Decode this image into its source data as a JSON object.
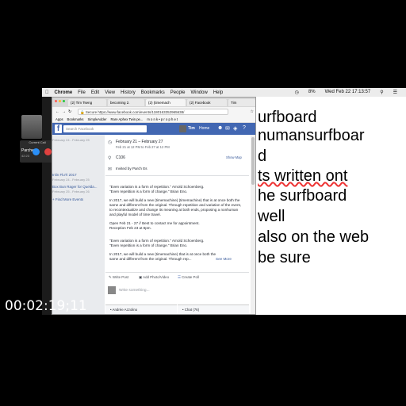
{
  "menubar": {
    "app": "Chrome",
    "items": [
      "File",
      "Edit",
      "View",
      "History",
      "Bookmarks",
      "People",
      "Window",
      "Help"
    ],
    "clock": "Wed Feb 22  17:13:57",
    "battery": "8%"
  },
  "call": {
    "header": "Current Call",
    "name": "Parches",
    "duration": "42:23"
  },
  "tabs": [
    "(2) Tim Tseng",
    "becoming 2.",
    "(2) (timemach",
    "(2) Facebook",
    "Tim"
  ],
  "url": "Secure  https://www.facebook.com/events/1180163352965638/",
  "bookmarks": [
    "Apps",
    "Bookmarks",
    "SimpleAdder",
    "Rare Aphex Twin pe...",
    "m o n k • p r o p h e t"
  ],
  "fb": {
    "search_placeholder": "Search Facebook",
    "user": "Tim",
    "nav_home": "Home",
    "left_items": [
      {
        "title": "Inlin FluTi 2017",
        "sub": "February 24 - February 25"
      },
      {
        "title": "Box Bun Rager for Quelda...",
        "sub": "February 25 - February 26"
      },
      {
        "title": "+ Find More Events",
        "sub": ""
      }
    ],
    "left_top_sub": "February 24 - February 25"
  },
  "event": {
    "dates": "February 21 – February 27",
    "dates_sub": "Feb 21 at 12 PM to Feb 27 at 12 PM",
    "location": "C106",
    "show_map": "Show Map",
    "invited": "Invited by Parch Es",
    "p1": "\"Even variation is a form of repetition.\" Arnold Schoenberg.",
    "p2": "\"Even repetition is a form of change.\" Brian Eno.",
    "p3": "In 2017, we will build a new (timemachine) (timemachine) that is at once both the same and different from the original. Through repetition and variation of the event, to recontextualize and change its meaning at both ends, proposing a nonhuman and playful model of time travel.",
    "p4": "Open Feb 21 - 27 // Best to contact me for appointment.",
    "p5": "Reception Feb 23 at 8pm.",
    "p6": "\"Even variation is a form of repetition.\" Arnold Schoenberg.",
    "p7": "\"Even repetition is a form of change.\" Brian Eno.",
    "p8": "In 2017, we will build a new (timemachine) that is at once both the same and different from the original. Through rep...",
    "see_more": "See More",
    "write_post": "Write Post",
    "add_photo": "Add Photo/Video",
    "create_poll": "Create Poll",
    "write_placeholder": "Write something...",
    "chat_friend": "• Andrée Azzolino",
    "chat": "• Chat (76)"
  },
  "doc_lines": [
    "urfboard",
    "numansurfboar",
    "d",
    "ts written ont",
    "he surfboard",
    "well",
    "also on the web",
    "be sure"
  ],
  "timecode": "00:02:19;11",
  "colors": {
    "fb_blue": "#4267b2",
    "link": "#365899",
    "decline": "#e0413f",
    "accept": "#2a8ff7"
  }
}
